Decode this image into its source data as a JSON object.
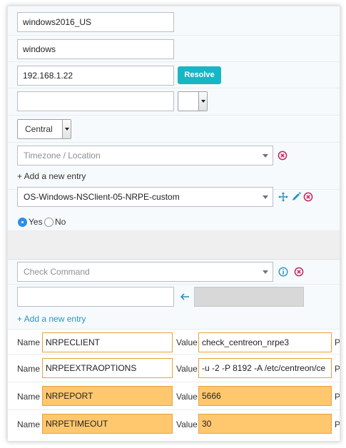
{
  "host": {
    "name": "windows2016_US",
    "alias": "windows",
    "address": "192.168.1.22",
    "resolve_label": "Resolve",
    "snmp_community": "",
    "monitored_from": "Central",
    "timezone_placeholder": "Timezone / Location"
  },
  "templates": {
    "add_entry_label": "+ Add a new entry",
    "selected": "OS-Windows-NSClient-05-NRPE-custom"
  },
  "create_services": {
    "yes_label": "Yes",
    "no_label": "No",
    "selected": "Yes"
  },
  "check": {
    "command_placeholder": "Check Command",
    "args_value": "",
    "add_entry_label": "+ Add a new entry"
  },
  "macros": {
    "name_label": "Name",
    "value_label": "Value",
    "trailing_label": "P",
    "rows": [
      {
        "name": "NRPECLIENT",
        "value": "check_centreon_nrpe3",
        "highlight": false
      },
      {
        "name": "NRPEEXTRAOPTIONS",
        "value": "-u -2 -P 8192 -A /etc/centreon/ce",
        "highlight": false
      },
      {
        "name": "NRPEPORT",
        "value": "5666",
        "highlight": true
      },
      {
        "name": "NRPETIMEOUT",
        "value": "30",
        "highlight": true
      }
    ]
  },
  "colors": {
    "accent": "#17b6c5",
    "link": "#2a94bf",
    "delete": "#c0285c",
    "macro_border": "#e6a23c",
    "macro_fill": "#ffc76e"
  }
}
